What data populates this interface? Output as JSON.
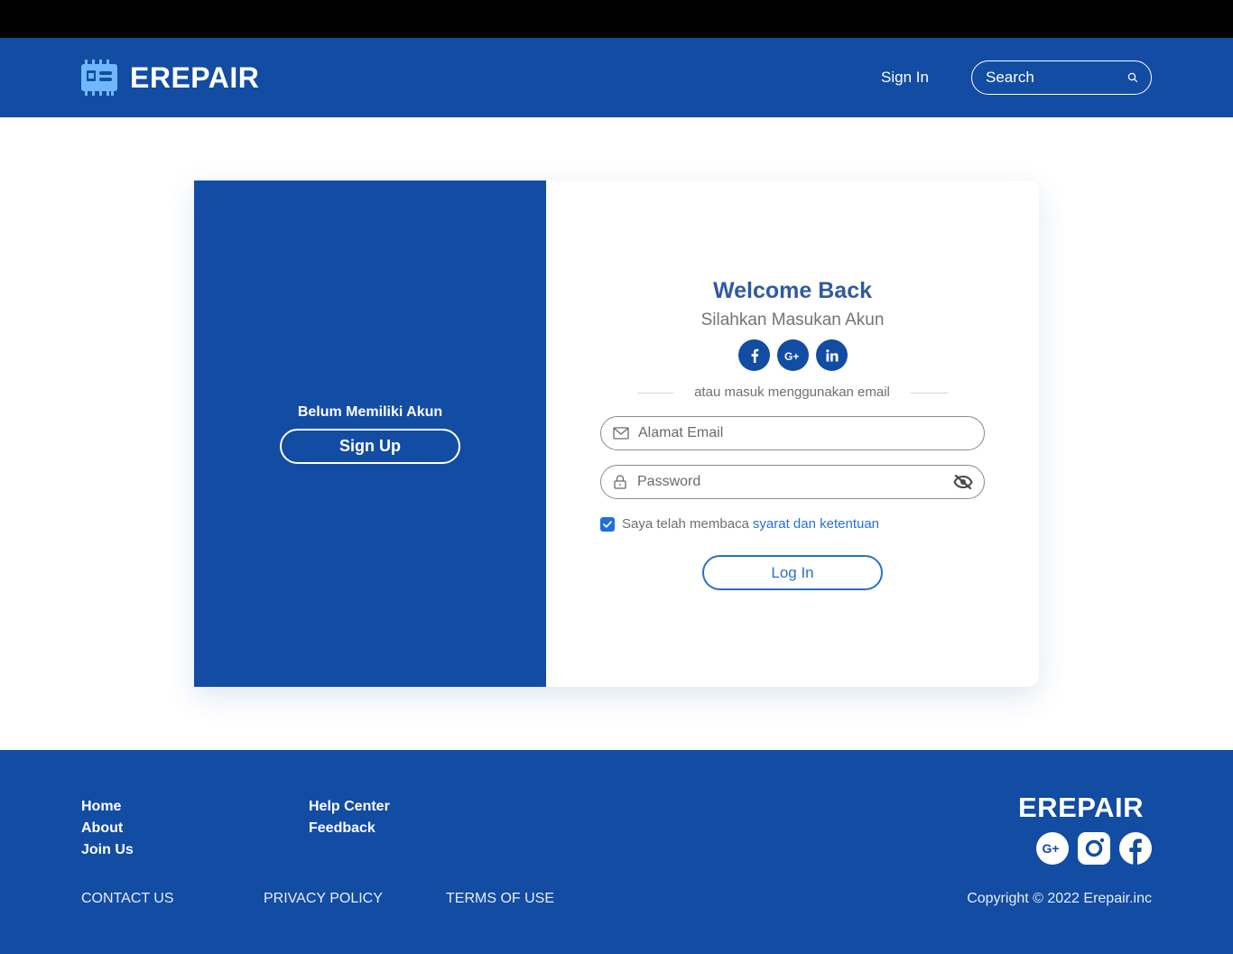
{
  "header": {
    "brand": "EREPAIR",
    "signin_label": "Sign In",
    "search_placeholder": "Search"
  },
  "left_panel": {
    "prompt": "Belum Memiliki Akun",
    "signup_label": "Sign Up"
  },
  "login": {
    "title": "Welcome Back",
    "subtitle": "Silahkan Masukan Akun",
    "social_icons": [
      "facebook-icon",
      "google-plus-icon",
      "linkedin-icon"
    ],
    "divider_text": "atau masuk menggunakan email",
    "email_placeholder": "Alamat Email",
    "password_placeholder": "Password",
    "terms_text": "Saya telah membaca",
    "terms_link": "syarat dan ketentuan",
    "terms_checked": true,
    "login_label": "Log In"
  },
  "footer": {
    "col1": [
      "Home",
      "About",
      "Join Us"
    ],
    "col2": [
      "Help Center",
      "Feedback"
    ],
    "links": [
      "CONTACT US",
      "PRIVACY POLICY",
      "TERMS OF USE"
    ],
    "brand": "EREPAIR",
    "social_icons": [
      "google-plus-icon",
      "instagram-icon",
      "facebook-icon"
    ],
    "copyright": "Copyright © 2022 Erepair.inc"
  },
  "colors": {
    "brand_blue": "#124ca3",
    "link_blue": "#2a6fd3",
    "title_blue": "#2f5b9e"
  }
}
